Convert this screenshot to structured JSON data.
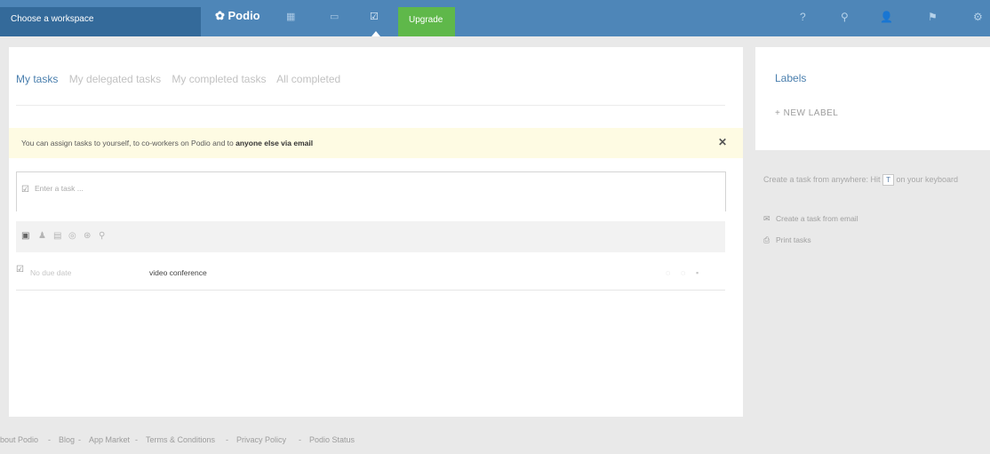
{
  "topbar": {
    "workspace_label": "Choose a workspace",
    "logo": "Podio",
    "nav_icons": [
      {
        "name": "workspace-grid-icon",
        "glyph": "▦"
      },
      {
        "name": "calendar-icon",
        "glyph": "▭"
      },
      {
        "name": "tasks-icon",
        "glyph": "☑"
      }
    ],
    "upgrade_label": "Upgrade",
    "right_icons": [
      {
        "name": "help-icon",
        "glyph": "?"
      },
      {
        "name": "search-icon",
        "glyph": "⚲"
      },
      {
        "name": "user-icon",
        "glyph": "👤"
      },
      {
        "name": "notifications-icon",
        "glyph": "⚑"
      },
      {
        "name": "settings-icon",
        "glyph": "⚙"
      }
    ],
    "colors": {
      "bar": "#4e86b8",
      "workspace": "#346a9a",
      "upgrade": "#5fb84a"
    }
  },
  "tabs": [
    {
      "label": "My tasks",
      "active": true
    },
    {
      "label": "My delegated tasks",
      "active": false
    },
    {
      "label": "My completed tasks",
      "active": false
    },
    {
      "label": "All completed",
      "active": false
    }
  ],
  "notice": {
    "text_before": "You can assign tasks to yourself, to co-workers on Podio and to",
    "text_bold": "anyone else via email",
    "close_glyph": "✕"
  },
  "task_input": {
    "placeholder": "Enter a task ...",
    "value": ""
  },
  "toolbar_icons": [
    {
      "name": "due-date-icon",
      "glyph": "▣"
    },
    {
      "name": "assignee-icon",
      "glyph": "♟"
    },
    {
      "name": "reference-icon",
      "glyph": "▤"
    },
    {
      "name": "reminder-icon",
      "glyph": "◎"
    },
    {
      "name": "repeat-icon",
      "glyph": "⊛"
    },
    {
      "name": "label-icon",
      "glyph": "⚲"
    }
  ],
  "tasks": [
    {
      "due": "No due date",
      "title": "video conference"
    }
  ],
  "labels": {
    "title": "Labels",
    "new_label": "+ NEW LABEL"
  },
  "side_hint": {
    "before": "Create a task from anywhere: Hit",
    "key": "T",
    "after": "on your keyboard"
  },
  "side_links": [
    {
      "icon": "email-icon",
      "glyph": "✉",
      "label": "Create a task from email"
    },
    {
      "icon": "print-icon",
      "glyph": "⎙",
      "label": "Print tasks"
    }
  ],
  "footer": [
    "bout Podio",
    "-",
    "Blog",
    "-",
    "App Market",
    "-",
    "Terms & Conditions",
    "-",
    "Privacy Policy",
    "-",
    "Podio Status"
  ]
}
